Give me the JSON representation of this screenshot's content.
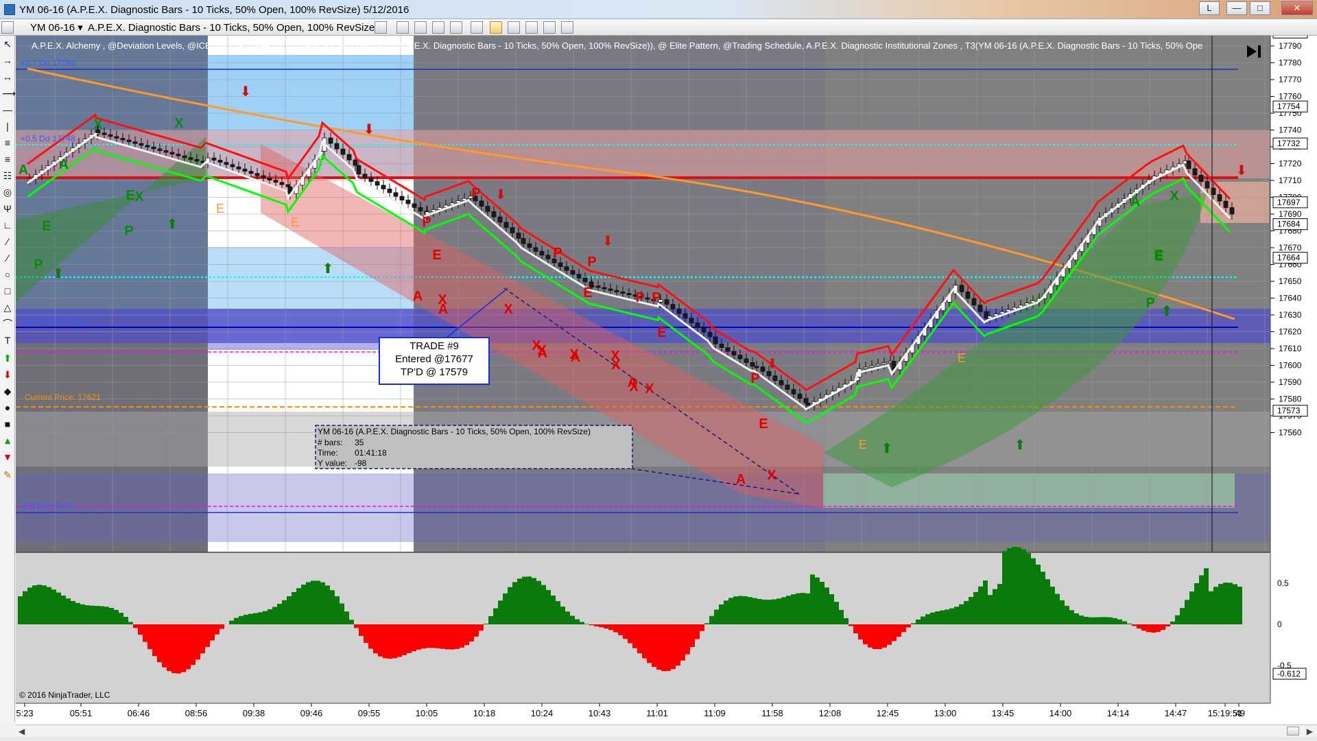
{
  "window": {
    "title": "YM 06-16 (A.P.E.X. Diagnostic Bars - 10 Ticks, 50% Open, 100% RevSize)  5/12/2016",
    "buttons": {
      "restore_label": "L",
      "minimize_label": "—",
      "maximize_label": "□",
      "close_label": "✕"
    }
  },
  "toolbar": {
    "instrument": "YM 06-16",
    "bar_type": "A.P.E.X. Diagnostic Bars - 10 Ticks, 50% Open, 100% RevSize"
  },
  "chart": {
    "indicator_line": "A.P.E.X. Alchemy , @Deviation Levels, @ICE Volume Zones v2, CurrentDayOHL(YM 06-16 (A.P.E.X. Diagnostic Bars - 10 Ticks, 50% Open, 100% RevSize)), @ Elite Pattern, @Trading Schedule, A.P.E.X. Diagnostic Institutional Zones , T3(YM 06-16 (A.P.E.X. Diagnostic Bars - 10 Ticks, 50% Ope",
    "level_labels": {
      "dev_plus_07": "+0.7 Dσ 17784",
      "dev_plus_05": "+0.5 Dσ 17748",
      "settlement": "Settlement 17659",
      "current_price": "Current Price: 17621",
      "dev_minus_05": "-0.5 Dσ 17570"
    },
    "trade_box": {
      "line1": "TRADE #9",
      "line2": "Entered @17677",
      "line3": "TP'D @ 17579"
    },
    "info_box": {
      "title": "YM 06-16 (A.P.E.X. Diagnostic Bars - 10 Ticks, 50% Open, 100% RevSize)",
      "bars_label": "# bars:",
      "bars_value": "35",
      "time_label": "Time:",
      "time_value": "01:41:18",
      "y_label": "Y value:",
      "y_value": "-98"
    },
    "copyright": "© 2016 NinjaTrader, LLC",
    "price_axis_labels": [
      "17790",
      "17780",
      "17770",
      "17760",
      "17750",
      "17740",
      "17730",
      "17720",
      "17710",
      "17700",
      "17690",
      "17680",
      "17670",
      "17660",
      "17650",
      "17640",
      "17630",
      "17620",
      "17610",
      "17600",
      "17590",
      "17580",
      "17570",
      "17560"
    ],
    "price_axis_tags": [
      {
        "label": "17798",
        "color": "#ffffff"
      },
      {
        "label": "17754",
        "color": "#ffffff"
      },
      {
        "label": "17732",
        "color": "#ffffff"
      },
      {
        "label": "17697",
        "color": "#ffffff"
      },
      {
        "label": "17684",
        "color": "#ffffff"
      },
      {
        "label": "17664",
        "color": "#ffffff"
      },
      {
        "label": "17573",
        "color": "#ffffff"
      }
    ],
    "osc_axis_labels": [
      "0.5",
      "0",
      "-0.5"
    ],
    "osc_axis_tag": "-0.612",
    "time_labels": [
      "5:23",
      "05:51",
      "06:46",
      "08:56",
      "09:38",
      "09:46",
      "09:55",
      "10:05",
      "10:18",
      "10:24",
      "10:43",
      "11:01",
      "11:09",
      "11:58",
      "12:08",
      "12:45",
      "13:00",
      "13:45",
      "14:00",
      "14:14",
      "14:47",
      "15:19:51",
      ":49"
    ],
    "pattern_letters": {
      "green": [
        "A",
        "X",
        "A",
        "X",
        "E",
        "X",
        "E",
        "P",
        "P",
        "A",
        "X",
        "P",
        "E",
        "E"
      ],
      "red": [
        "P",
        "P",
        "P",
        "P",
        "P",
        "P",
        "P",
        "A",
        "X",
        "A",
        "X",
        "X",
        "A",
        "X",
        "X",
        "A",
        "X",
        "A",
        "X",
        "A",
        "X",
        "E",
        "E",
        "E",
        "E",
        "X",
        "X"
      ],
      "orange": [
        "E",
        "E",
        "E",
        "E"
      ]
    },
    "colors": {
      "bull": "#008000",
      "bear": "#ff0000",
      "chart_bg": "#808080",
      "zone_blue": "#5050c8",
      "zone_light_blue": "#9fd0f5",
      "current_price_line": "#ff8c00",
      "dev_line": "#00ffff",
      "settlement_line": "#0000c0",
      "magenta_line": "#ff00ff"
    }
  }
}
